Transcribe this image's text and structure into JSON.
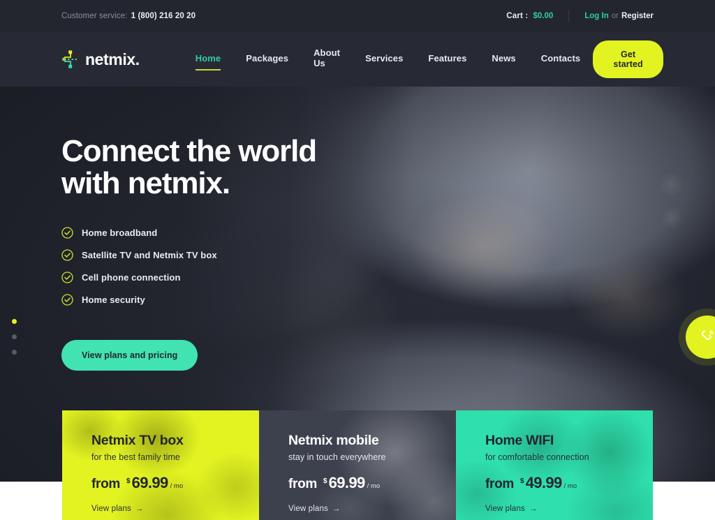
{
  "topbar": {
    "customer_service_label": "Customer service:",
    "customer_service_phone": "1 (800) 216 20 20",
    "cart_label": "Cart :",
    "cart_amount": "$0.00",
    "login_label": "Log In",
    "or_label": "or",
    "register_label": "Register"
  },
  "header": {
    "logo_text": "netmix.",
    "logo_icon": "network-node-icon",
    "nav": [
      {
        "label": "Home",
        "active": true
      },
      {
        "label": "Packages",
        "active": false
      },
      {
        "label": "About Us",
        "active": false
      },
      {
        "label": "Services",
        "active": false
      },
      {
        "label": "Features",
        "active": false
      },
      {
        "label": "News",
        "active": false
      },
      {
        "label": "Contacts",
        "active": false
      }
    ],
    "cta_label": "Get started"
  },
  "hero": {
    "title": "Connect the world\nwith netmix.",
    "features": [
      {
        "label": "Home broadband",
        "icon": "check-circle-icon"
      },
      {
        "label": "Satellite TV and Netmix TV box",
        "icon": "check-circle-icon"
      },
      {
        "label": "Cell phone connection",
        "icon": "check-circle-icon"
      },
      {
        "label": "Home security",
        "icon": "check-circle-icon"
      }
    ],
    "cta_label": "View plans and pricing",
    "slider_dots": [
      {
        "active": true
      },
      {
        "active": false
      },
      {
        "active": false
      }
    ],
    "call_button_icon": "phone-call-icon"
  },
  "cards": [
    {
      "title": "Netmix TV box",
      "subtitle": "for the best family time",
      "price_from": "from",
      "currency": "$",
      "price": "69.99",
      "period": "/ mo",
      "link_label": "View plans",
      "link_arrow": "→",
      "theme": "yellow"
    },
    {
      "title": "Netmix mobile",
      "subtitle": "stay in touch everywhere",
      "price_from": "from",
      "currency": "$",
      "price": "69.99",
      "period": "/ mo",
      "link_label": "View plans",
      "link_arrow": "→",
      "theme": "dark"
    },
    {
      "title": "Home WIFI",
      "subtitle": "for comfortable connection",
      "price_from": "from",
      "currency": "$",
      "price": "49.99",
      "period": "/ mo",
      "link_label": "View plans",
      "link_arrow": "→",
      "theme": "teal"
    }
  ],
  "colors": {
    "accent_yellow": "#e2f321",
    "accent_green": "#2ecf9a",
    "accent_mint": "#41e3b2",
    "dark_bg": "#23262f",
    "header_bg": "#272a35"
  }
}
